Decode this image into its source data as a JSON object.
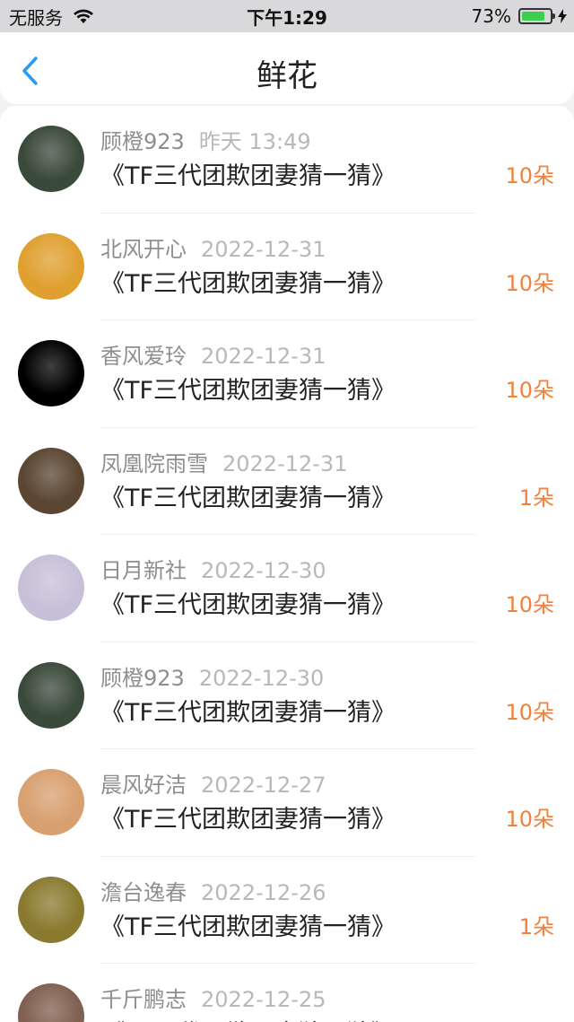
{
  "status": {
    "carrier": "无服务",
    "time": "下午1:29",
    "battery": "73%",
    "battery_level": 0.73
  },
  "nav": {
    "title": "鲜花",
    "back_icon": "chevron-left-icon"
  },
  "colors": {
    "accent_blue": "#2b9bf0",
    "amount_orange": "#f0813a",
    "battery_green": "#3ccf4e"
  },
  "items": [
    {
      "name": "顾橙923",
      "date": "昨天 13:49",
      "subject": "《TF三代团欺团妻猜一猜》",
      "amount": "10朵",
      "avatar_color": "#3a4a3a"
    },
    {
      "name": "北风开心",
      "date": "2022-12-31",
      "subject": "《TF三代团欺团妻猜一猜》",
      "amount": "10朵",
      "avatar_color": "#e0a030"
    },
    {
      "name": "香风爱玲",
      "date": "2022-12-31",
      "subject": "《TF三代团欺团妻猜一猜》",
      "amount": "10朵",
      "avatar_color": "#000000"
    },
    {
      "name": "凤凰院雨雪",
      "date": "2022-12-31",
      "subject": "《TF三代团欺团妻猜一猜》",
      "amount": "1朵",
      "avatar_color": "#5a4632"
    },
    {
      "name": "日月新社",
      "date": "2022-12-30",
      "subject": "《TF三代团欺团妻猜一猜》",
      "amount": "10朵",
      "avatar_color": "#c8c0d8"
    },
    {
      "name": "顾橙923",
      "date": "2022-12-30",
      "subject": "《TF三代团欺团妻猜一猜》",
      "amount": "10朵",
      "avatar_color": "#3a4a3a"
    },
    {
      "name": "晨风好洁",
      "date": "2022-12-27",
      "subject": "《TF三代团欺团妻猜一猜》",
      "amount": "10朵",
      "avatar_color": "#d8a070"
    },
    {
      "name": "澹台逸春",
      "date": "2022-12-26",
      "subject": "《TF三代团欺团妻猜一猜》",
      "amount": "1朵",
      "avatar_color": "#8a7a30"
    },
    {
      "name": "千斤鹏志",
      "date": "2022-12-25",
      "subject": "《TF三代团欺团妻猜一猜》",
      "amount": "",
      "avatar_color": "#806050"
    }
  ]
}
